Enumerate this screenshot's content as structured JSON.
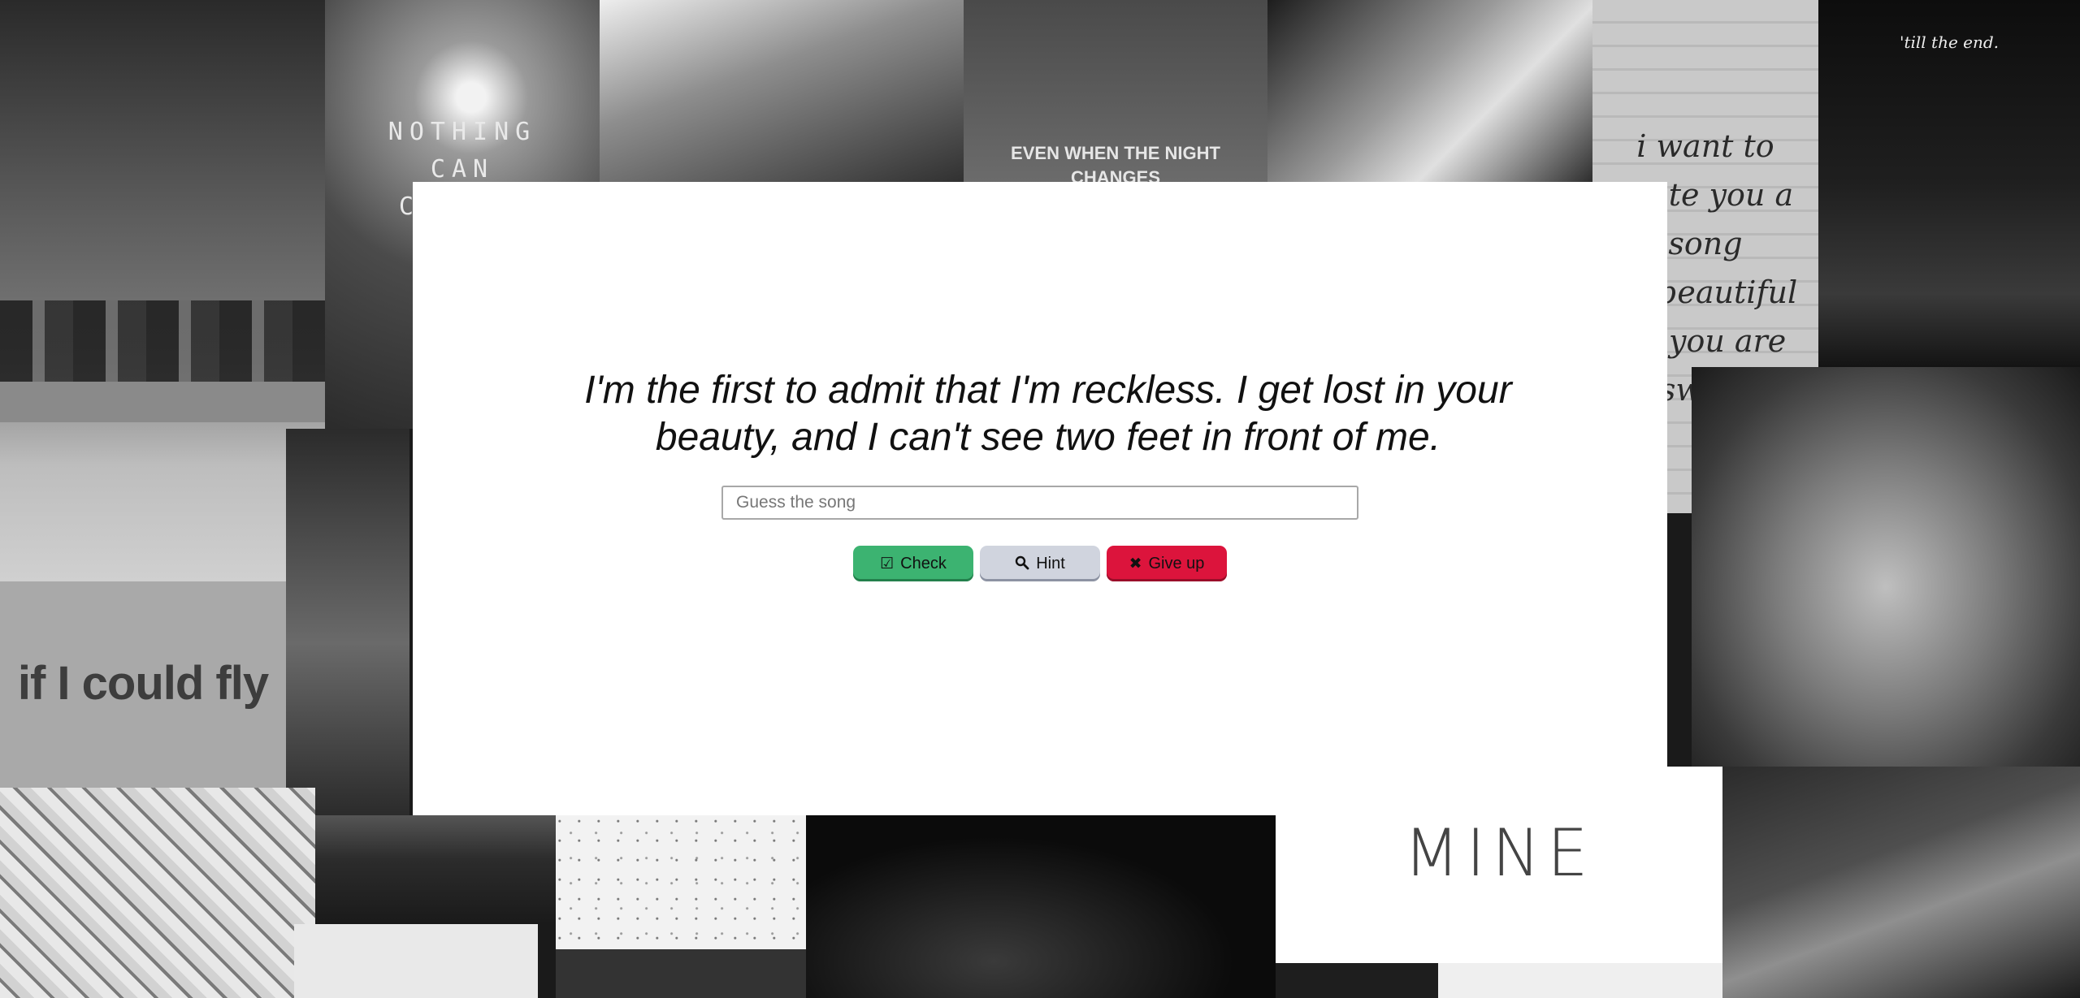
{
  "background_tiles": {
    "nothing_can": "NOTHING\nCAN\nCHANGE\nBE\nYOU",
    "night_changes": "EVEN WHEN THE NIGHT\nCHANGES",
    "i_want_to": "i want to\nwrite you a song\nas beautiful\nas you are sweet",
    "till_the_end": "'till the end.",
    "if_i_could_fly": "if I could fly",
    "mine": "MINE"
  },
  "quiz": {
    "lyric": "I'm the first to admit that I'm reckless. I get lost in your beauty, and I can't see two feet in front of me.",
    "input_placeholder": "Guess the song",
    "input_value": "",
    "buttons": {
      "check": {
        "label": "Check",
        "icon": "check-square-icon",
        "color": "#3cb371"
      },
      "hint": {
        "label": "Hint",
        "icon": "search-icon",
        "color": "#d0d4de"
      },
      "give_up": {
        "label": "Give up",
        "icon": "close-icon",
        "color": "#dc143c"
      }
    }
  }
}
